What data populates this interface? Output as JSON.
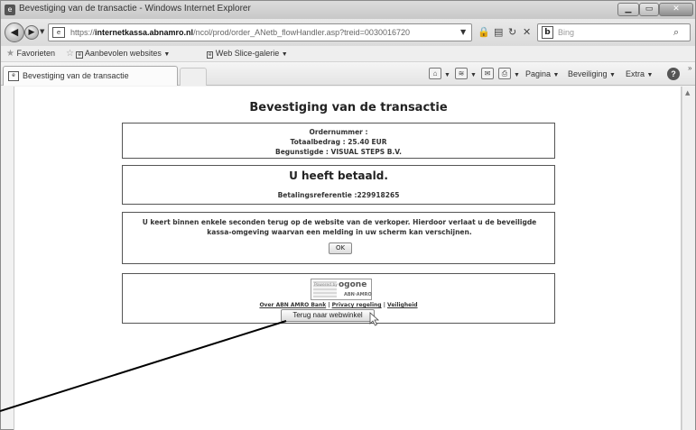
{
  "window": {
    "title": "Bevestiging van de transactie - Windows Internet Explorer"
  },
  "address_bar": {
    "url_prefix": "https://",
    "url_domain": "internetkassa.abnamro.nl",
    "url_rest": "/ncol/prod/order_ANetb_flowHandler.asp?treid=0030016720"
  },
  "search": {
    "placeholder": "Bing"
  },
  "favorites_bar": {
    "favorites_label": "Favorieten",
    "suggested_sites": "Aanbevolen websites",
    "web_slice_gallery": "Web Slice-galerie"
  },
  "tab": {
    "title": "Bevestiging van de transactie"
  },
  "command_bar": {
    "page": "Pagina",
    "safety": "Beveiliging",
    "tools": "Extra"
  },
  "page": {
    "heading": "Bevestiging van de transactie",
    "order_number": "Ordernummer :",
    "total_amount": "Totaalbedrag : 25.40 EUR",
    "beneficiary": "Begunstigde : VISUAL STEPS B.V.",
    "paid_title": "U heeft betaald.",
    "payment_reference": "Betalingsreferentie :229918265",
    "notice": "U keert binnen enkele seconden terug op de website van de verkoper. Hierdoor verlaat u de beveiligde kassa-omgeving waarvan een melding in uw scherm kan verschijnen.",
    "ok_button": "OK",
    "logo_powered_by": "Powered by",
    "logo_brand": "ogone",
    "logo_bank": "ABN·AMRO",
    "link_about": "Over ABN AMRO Bank",
    "link_privacy": "Privacy regeling",
    "link_security": "Veiligheid",
    "link_separator": "|",
    "back_to_shop_button": "Terug naar webwinkel"
  },
  "icons": {
    "back": "back-arrow-icon",
    "forward": "forward-arrow-icon",
    "lock": "lock-icon",
    "refresh": "refresh-icon",
    "stop": "stop-icon",
    "search": "search-icon",
    "home": "home-icon",
    "feeds": "feeds-icon",
    "mail": "mail-icon",
    "print": "print-icon",
    "help": "help-icon"
  }
}
